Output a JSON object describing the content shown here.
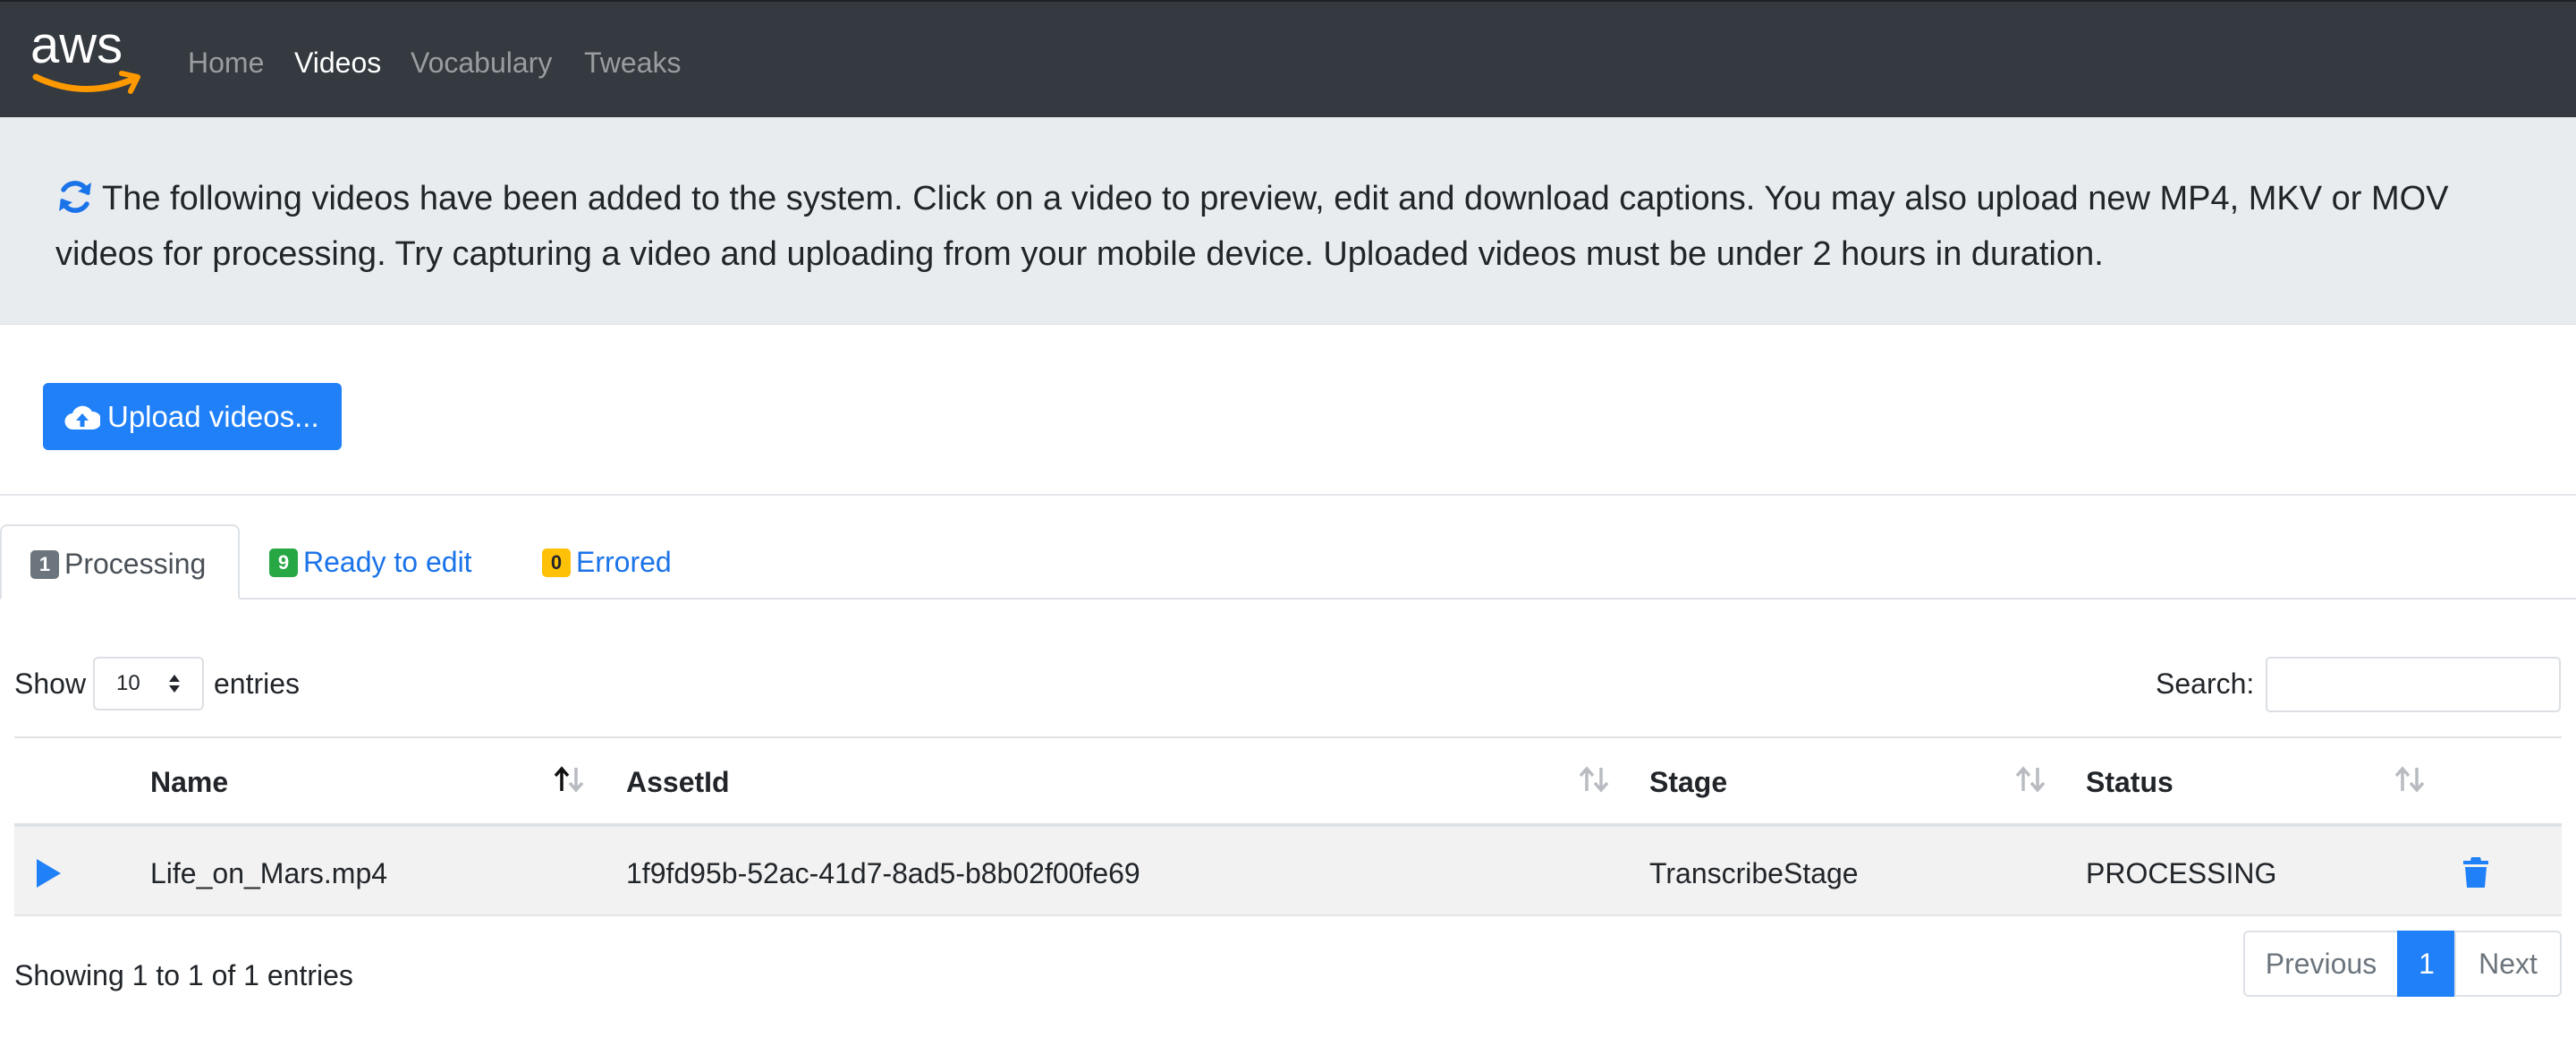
{
  "nav": {
    "logo_text": "aws",
    "links": [
      "Home",
      "Videos",
      "Vocabulary",
      "Tweaks"
    ],
    "active": "Videos"
  },
  "intro": {
    "icon": "refresh-icon",
    "text": "The following videos have been added to the system. Click on a video to preview, edit and download captions. You may also upload new MP4, MKV or MOV videos for processing. Try capturing a video and uploading from your mobile device. Uploaded videos must be under 2 hours in duration."
  },
  "upload": {
    "label": "Upload videos...",
    "icon": "cloud-upload-icon"
  },
  "tabs": [
    {
      "count": "1",
      "label": "Processing",
      "badge_color": "#6c757d",
      "active": true
    },
    {
      "count": "9",
      "label": "Ready to edit",
      "badge_color": "#28a745",
      "active": false
    },
    {
      "count": "0",
      "label": "Errored",
      "badge_color": "#ffc107",
      "active": false
    }
  ],
  "table_controls": {
    "show_label": "Show",
    "page_size": "10",
    "entries_label": "entries",
    "search_label": "Search:",
    "search_value": ""
  },
  "table": {
    "columns": [
      "Name",
      "AssetId",
      "Stage",
      "Status"
    ],
    "rows": [
      {
        "name": "Life_on_Mars.mp4",
        "asset_id": "1f9fd95b-52ac-41d7-8ad5-b8b02f00fe69",
        "stage": "TranscribeStage",
        "status": "PROCESSING"
      }
    ]
  },
  "footer": {
    "info": "Showing 1 to 1 of 1 entries",
    "prev": "Previous",
    "page": "1",
    "next": "Next"
  },
  "colors": {
    "navbar": "#343a40",
    "primary": "#2080f8",
    "jumbotron": "#e9ecef",
    "aws_orange": "#ff9900"
  }
}
